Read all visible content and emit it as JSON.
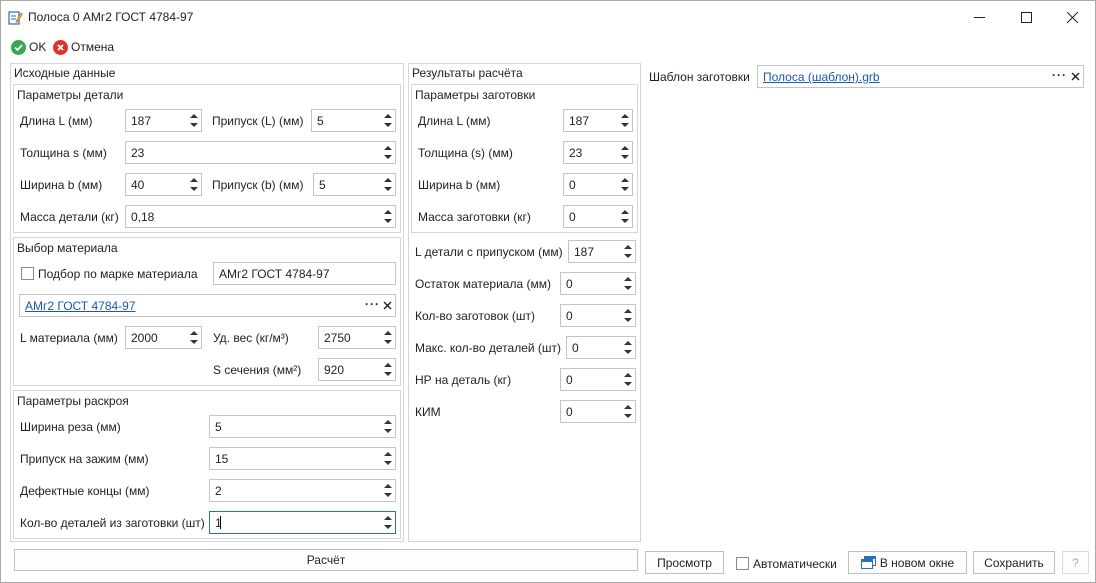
{
  "window": {
    "title": "Полоса 0 АМг2 ГОСТ 4784-97"
  },
  "toolbar": {
    "ok_label": "OK",
    "cancel_label": "Отмена"
  },
  "source": {
    "title": "Исходные данные",
    "part": {
      "title": "Параметры детали",
      "length_label": "Длина L (мм)",
      "length_value": "187",
      "allowance_l_label": "Припуск (L) (мм)",
      "allowance_l_value": "5",
      "thickness_label": "Толщина s (мм)",
      "thickness_value": "23",
      "width_label": "Ширина b (мм)",
      "width_value": "40",
      "allowance_b_label": "Припуск (b) (мм)",
      "allowance_b_value": "5",
      "mass_label": "Масса детали (кг)",
      "mass_value": "0,18"
    },
    "material": {
      "title": "Выбор материала",
      "brand_check_label": "Подбор по марке материала",
      "brand_value": "АМг2 ГОСТ 4784-97",
      "selected_link": "АМг2 ГОСТ 4784-97",
      "length_label": "L материала (мм)",
      "length_value": "2000",
      "density_label": "Уд. вес (кг/м³)",
      "density_value": "2750",
      "section_label": "S сечения (мм²)",
      "section_value": "920"
    },
    "cutting": {
      "title": "Параметры раскроя",
      "kerf_label": "Ширина реза (мм)",
      "kerf_value": "5",
      "clamp_label": "Припуск на зажим (мм)",
      "clamp_value": "15",
      "defect_label": "Дефектные концы (мм)",
      "defect_value": "2",
      "count_label": "Кол-во деталей из заготовки (шт)",
      "count_value": "1"
    }
  },
  "results": {
    "title": "Результаты расчёта",
    "blank": {
      "title": "Параметры заготовки",
      "length_label": "Длина L (мм)",
      "length_value": "187",
      "thickness_label": "Толщина (s) (мм)",
      "thickness_value": "23",
      "width_label": "Ширина b (мм)",
      "width_value": "0",
      "mass_label": "Масса заготовки (кг)",
      "mass_value": "0"
    },
    "l_allowance_label": "L детали с припуском (мм)",
    "l_allowance_value": "187",
    "remainder_label": "Остаток материала (мм)",
    "remainder_value": "0",
    "blanks_count_label": "Кол-во заготовок (шт)",
    "blanks_count_value": "0",
    "max_parts_label": "Макс. кол-во деталей (шт)",
    "max_parts_value": "0",
    "norm_label": "НР на деталь (кг)",
    "norm_value": "0",
    "kim_label": "КИМ",
    "kim_value": "0"
  },
  "template": {
    "label": "Шаблон заготовки",
    "link": "Полоса (шаблон).grb"
  },
  "footer": {
    "calc_label": "Расчёт",
    "preview_label": "Просмотр",
    "auto_label": "Автоматически",
    "new_window_label": "В новом окне",
    "save_label": "Сохранить",
    "help_label": "?"
  },
  "colors": {
    "ok_green": "#3aa655",
    "cancel_red": "#d9352b",
    "link_blue": "#1a56b5",
    "focus_blue": "#2a6ebf"
  }
}
